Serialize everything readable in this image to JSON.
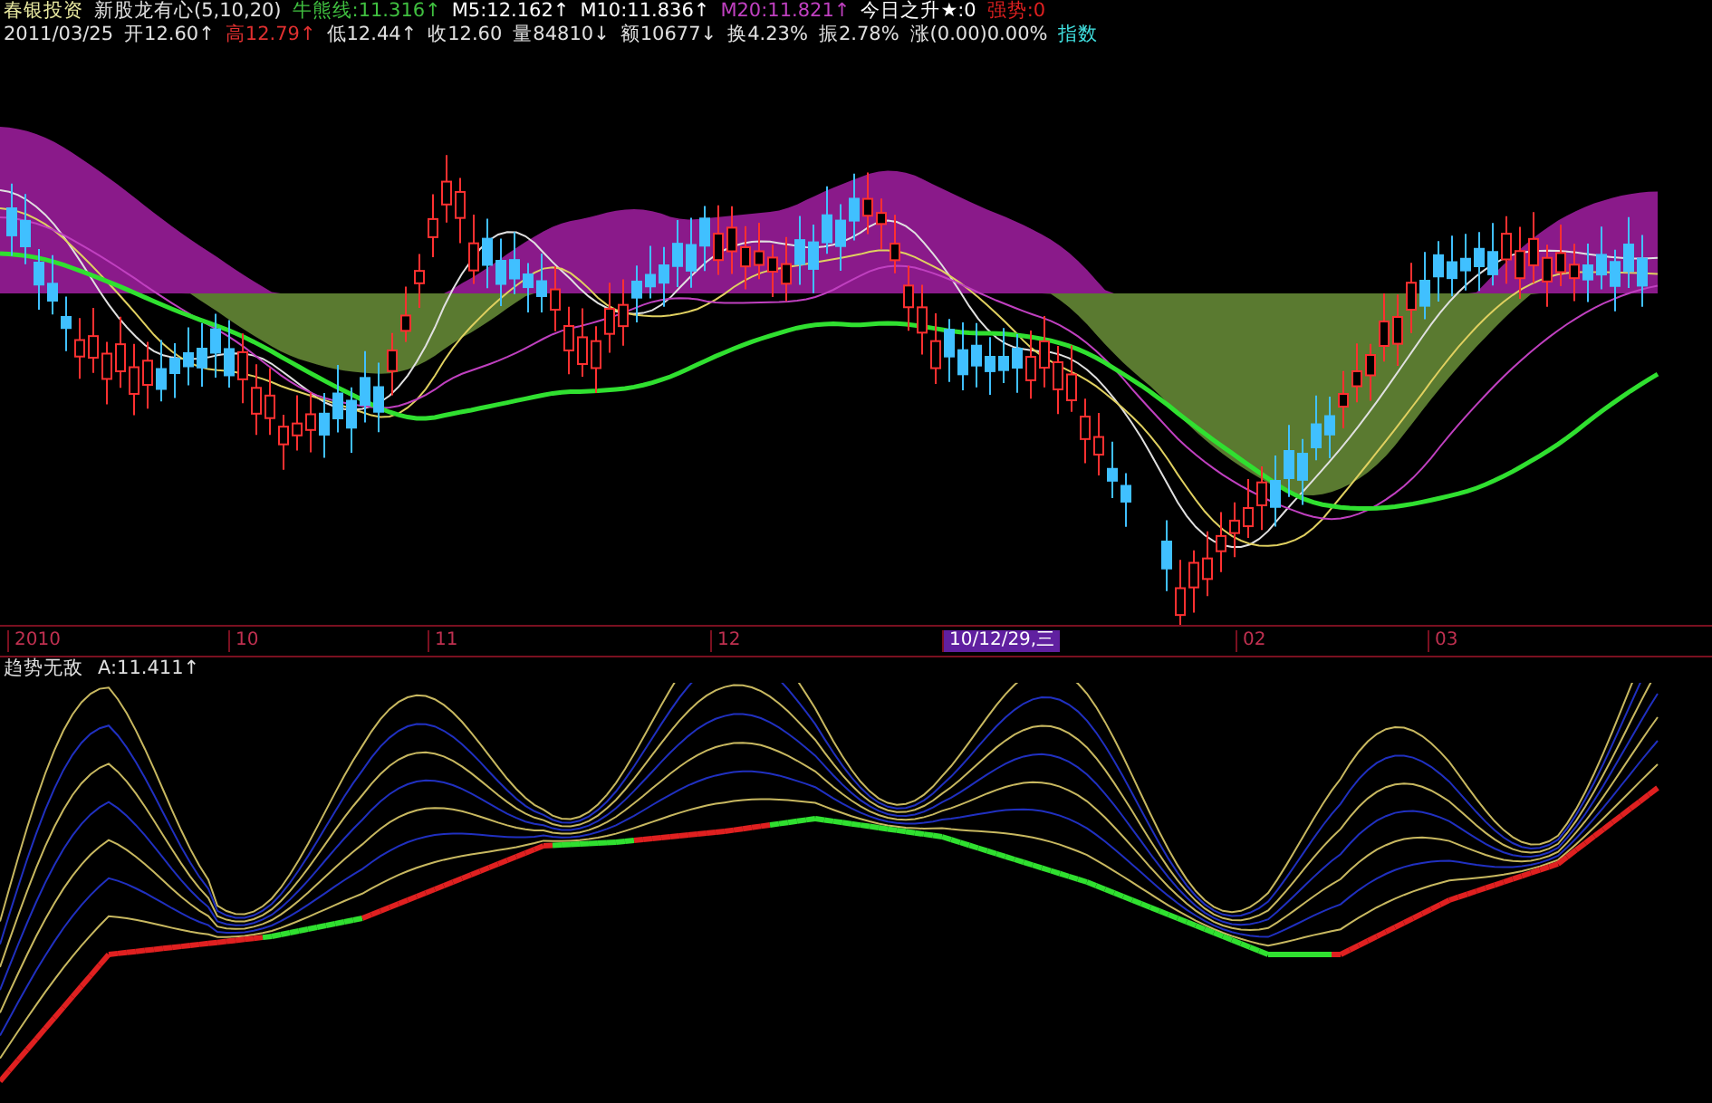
{
  "header_rows": [
    [
      {
        "text": "春银投资",
        "color": "#e8e8a0"
      },
      {
        "text": "新股龙有心(5,10,20)",
        "color": "#e0e0e0"
      },
      {
        "text": "牛熊线:11.316↑",
        "color": "#40c040"
      },
      {
        "text": "M5:12.162↑",
        "color": "#ffffff"
      },
      {
        "text": "M10:11.836↑",
        "color": "#ffffff"
      },
      {
        "text": "M20:11.821↑",
        "color": "#c040c0"
      },
      {
        "text": "今日之升★:0",
        "color": "#ffffff"
      },
      {
        "text": "强势:0",
        "color": "#e02020"
      }
    ],
    [
      {
        "text": "2011/03/25",
        "color": "#e0e0e0"
      },
      {
        "text": "开12.60↑",
        "color": "#e0e0e0"
      },
      {
        "text": "高12.79↑",
        "color": "#e03030"
      },
      {
        "text": "低12.44↑",
        "color": "#e0e0e0"
      },
      {
        "text": "收12.60",
        "color": "#e0e0e0"
      },
      {
        "text": "量84810↓",
        "color": "#e0e0e0"
      },
      {
        "text": "额10677↓",
        "color": "#e0e0e0"
      },
      {
        "text": "换4.23%",
        "color": "#e0e0e0"
      },
      {
        "text": "振2.78%",
        "color": "#e0e0e0"
      },
      {
        "text": "涨(0.00)0.00%",
        "color": "#e0e0e0"
      },
      {
        "text": "指数",
        "color": "#40e0e0"
      }
    ]
  ],
  "axis_labels": [
    {
      "text": "2010",
      "kind": "tick"
    },
    {
      "text": "10",
      "kind": "tick"
    },
    {
      "text": "11",
      "kind": "tick"
    },
    {
      "text": "12",
      "kind": "tick"
    },
    {
      "text": "10/12/29,三",
      "kind": "cursor"
    },
    {
      "text": "02",
      "kind": "tick"
    },
    {
      "text": "03",
      "kind": "tick"
    }
  ],
  "indicator": {
    "name": "趋势无敌",
    "value": "A:11.411↑"
  }
}
